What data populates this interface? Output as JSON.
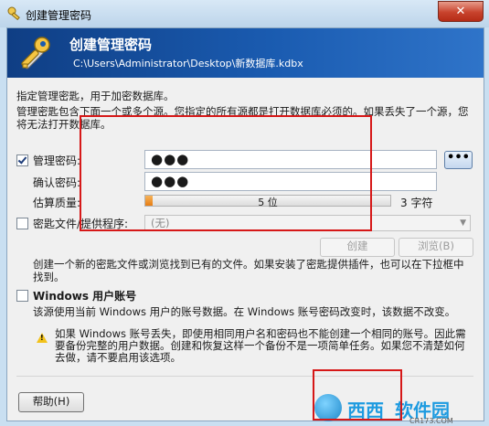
{
  "window": {
    "title": "创建管理密码",
    "close_label": "✕"
  },
  "banner": {
    "title": "创建管理密码",
    "path": "C:\\Users\\Administrator\\Desktop\\新数据库.kdbx",
    "icon": "key-icon"
  },
  "intro": {
    "line1": "指定管理密匙，用于加密数据库。",
    "line2": "管理密匙包含下面一个或多个源。您指定的所有源都是打开数据库必须的。如果丢失了一个源，您将无法打开数据库。"
  },
  "master_password": {
    "label": "管理密码:",
    "checked": true,
    "value": "●●●",
    "reveal_label": "•••"
  },
  "confirm": {
    "label": "确认密码:",
    "value": "●●●"
  },
  "quality": {
    "label": "估算质量:",
    "bar_text": "5 位",
    "fill_fraction": 0.03,
    "chars": "3 字符"
  },
  "keyfile": {
    "label": "密匙文件/提供程序:",
    "checked": false,
    "combo_value": "(无)",
    "create_label": "创建",
    "browse_label": "浏览(B)",
    "description": "创建一个新的密匙文件或浏览找到已有的文件。如果安装了密匙提供插件，也可以在下拉框中找到。"
  },
  "windows_account": {
    "label": "Windows 用户账号",
    "checked": false,
    "description": "该源使用当前 Windows 用户的账号数据。在 Windows 账号密码改变时，该数据不改变。",
    "warning": "如果 Windows 账号丢失，即使用相同用户名和密码也不能创建一个相同的账号。因此需要备份完整的用户数据。创建和恢复这样一个备份不是一项简单任务。如果您不清楚如何去做，请不要启用该选项。"
  },
  "footer": {
    "help_label": "帮助(H)"
  },
  "watermark": {
    "text1": "西西",
    "text2": "软件园",
    "url": "CR173.COM"
  },
  "colors": {
    "banner": "#1a5bb0",
    "annotation": "#d61818",
    "quality_fill": "#e67d12"
  }
}
